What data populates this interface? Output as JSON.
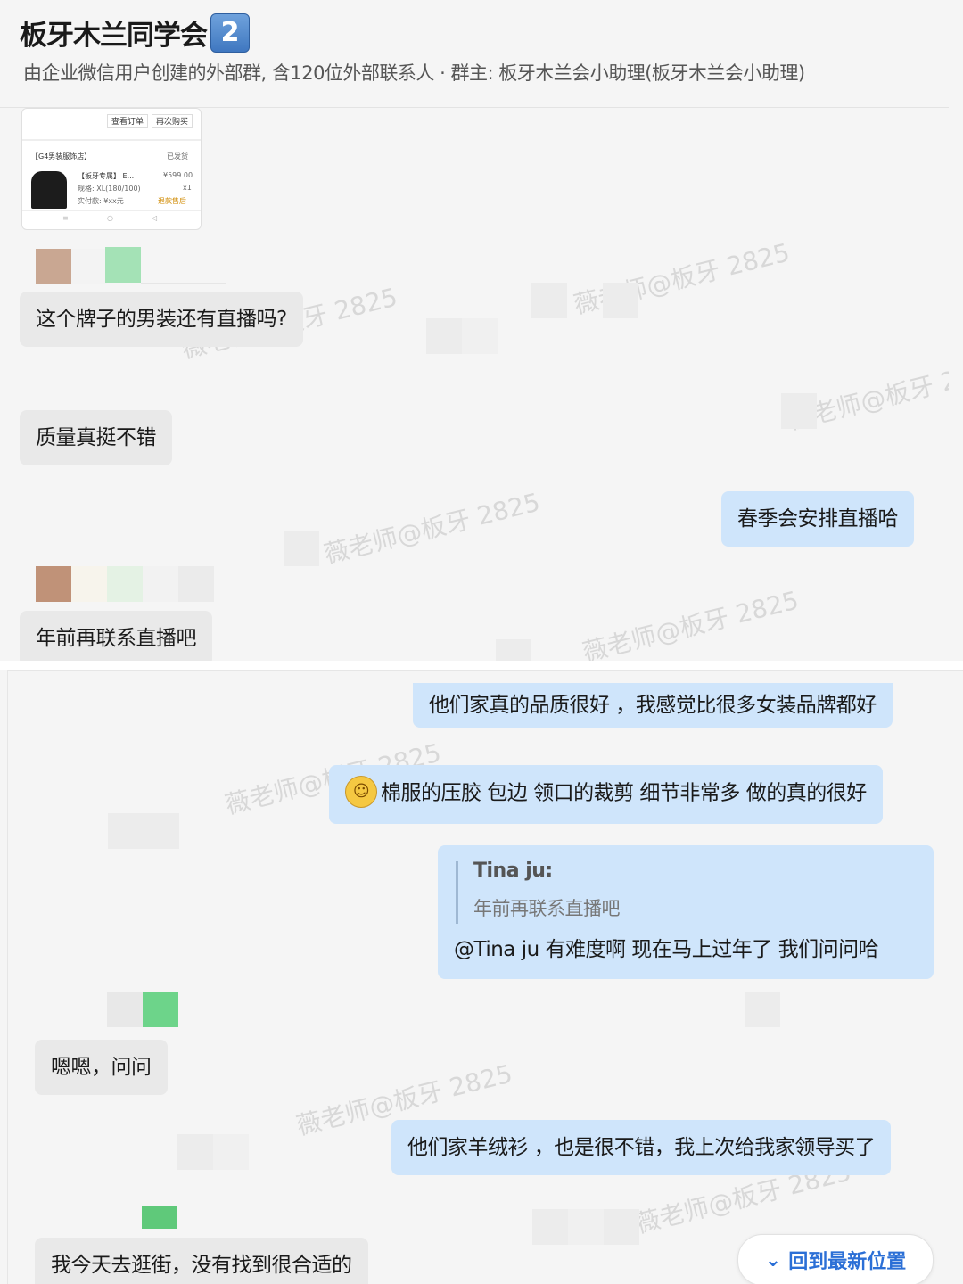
{
  "header": {
    "title": "板牙木兰同学会",
    "badge": "2",
    "subtitle": "由企业微信用户创建的外部群, 含120位外部联系人 · 群主: 板牙木兰会小助理(板牙木兰会小助理)"
  },
  "order_card": {
    "btn_left": "查看订单",
    "btn_right": "再次购买",
    "shop_row": "【G4男装服饰店】",
    "status": "已发货",
    "product_row": "【板牙专属】 E...",
    "price": "¥599.00",
    "spec_row": "规格: XL(180/100)",
    "qty": "x1",
    "extra_row": "实付款: ¥xx元",
    "tag": "退款售后"
  },
  "watermark_text": "薇老师@板牙 2825",
  "messages_top": [
    {
      "side": "left",
      "text": "这个牌子的男装还有直播吗?"
    },
    {
      "side": "left",
      "text": "质量真挺不错"
    },
    {
      "side": "right",
      "text": "春季会安排直播哈"
    },
    {
      "side": "left",
      "text": "年前再联系直播吧"
    }
  ],
  "messages_bottom": [
    {
      "side": "right",
      "text": "他们家真的品质很好 ，我感觉比很多女装品牌都好"
    },
    {
      "side": "right",
      "text": "棉服的压胶 包边 领口的裁剪  细节非常多  做的真的很好"
    },
    {
      "side": "right",
      "reply_name": "Tina ju:",
      "reply_text": "年前再联系直播吧",
      "text": "@Tina ju 有难度啊  现在马上过年了 我们问问哈"
    },
    {
      "side": "left",
      "text": "嗯嗯，问问"
    },
    {
      "side": "right",
      "text": "他们家羊绒衫 ，也是很不错，我上次给我家领导买了"
    },
    {
      "side": "left",
      "text": "我今天去逛街，没有找到很合适的"
    }
  ],
  "jump_button": {
    "label": "回到最新位置",
    "icon": "double-chevron-down-icon"
  },
  "colors": {
    "bubble_left": "#e9e9e9",
    "bubble_right": "#cfe5fb",
    "link": "#2b6fd6"
  }
}
